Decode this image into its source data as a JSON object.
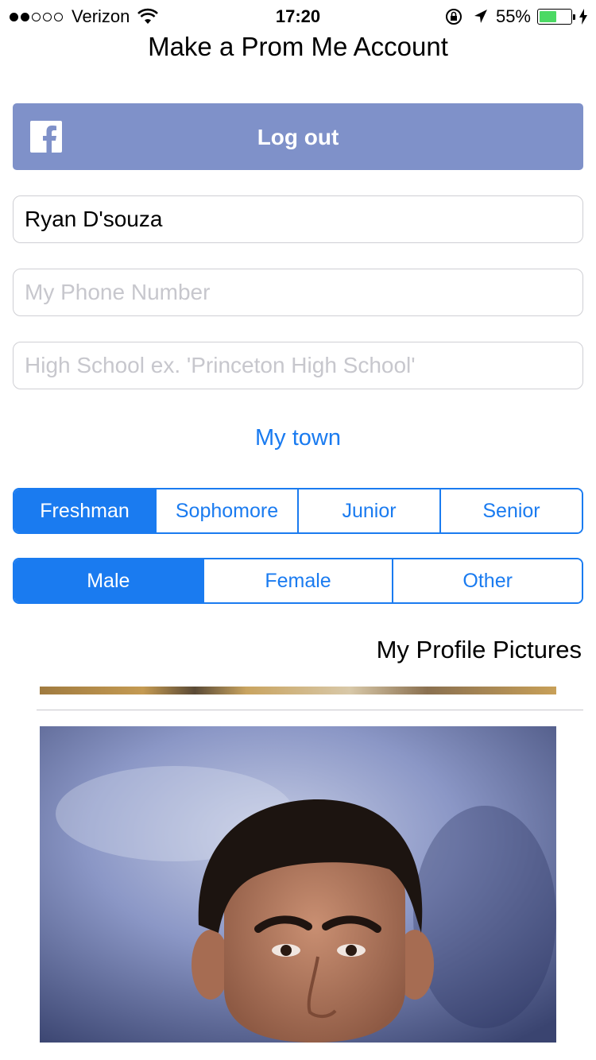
{
  "status_bar": {
    "carrier": "Verizon",
    "signal_bars_filled": 2,
    "signal_bars_total": 5,
    "time": "17:20",
    "battery_percent": "55%",
    "battery_level": 0.55,
    "battery_color": "#4cd964"
  },
  "page": {
    "title": "Make a Prom Me Account"
  },
  "facebook": {
    "button_label": "Log out",
    "icon": "facebook-icon",
    "color": "#7f91c9"
  },
  "form": {
    "name_value": "Ryan D'souza",
    "phone_placeholder": "My Phone Number",
    "school_placeholder": "High School ex. 'Princeton High School'",
    "town_label": "My town"
  },
  "grade": {
    "options": [
      "Freshman",
      "Sophomore",
      "Junior",
      "Senior"
    ],
    "selected": "Freshman"
  },
  "gender": {
    "options": [
      "Male",
      "Female",
      "Other"
    ],
    "selected": "Male"
  },
  "pictures": {
    "label": "My Profile Pictures"
  },
  "theme": {
    "accent": "#1a7bf0"
  }
}
